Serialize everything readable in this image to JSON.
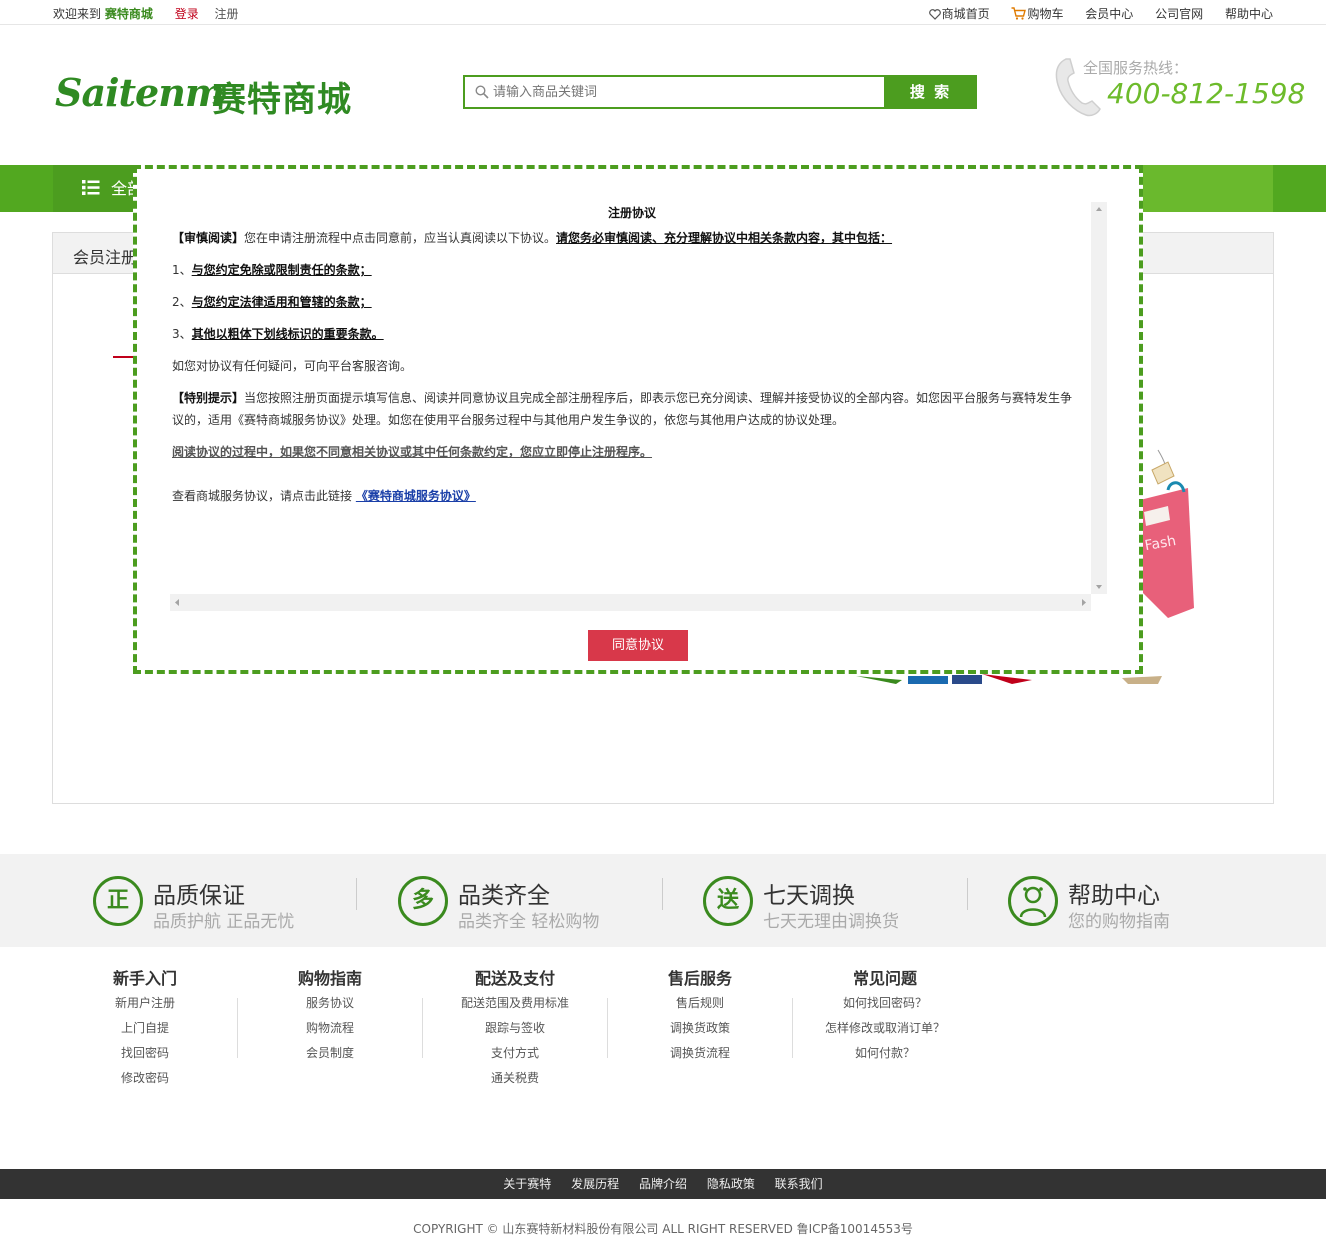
{
  "topbar": {
    "welcome": "欢迎来到",
    "brand": "赛特商城",
    "login": "登录",
    "register": "注册",
    "links": [
      "商城首页",
      "购物车",
      "会员中心",
      "公司官网",
      "帮助中心"
    ]
  },
  "header": {
    "logo_script": "Saitenm",
    "logo_cn": "赛特商城",
    "search_placeholder": "请输入商品关键词",
    "search_button": "搜 索",
    "hotline_label": "全国服务热线：",
    "hotline_number": "400-812-1598"
  },
  "nav": {
    "category_label": "全部"
  },
  "panel": {
    "title": "会员注册"
  },
  "modal": {
    "title": "注册协议",
    "p1_tag": "【审慎阅读】",
    "p1_text": "您在申请注册流程中点击同意前，应当认真阅读以下协议。",
    "p1_bold": "请您务必审慎阅读、充分理解协议中相关条款内容，其中包括：",
    "item1_num": "1、",
    "item1": "与您约定免除或限制责任的条款；",
    "item2_num": "2、",
    "item2": "与您约定法律适用和管辖的条款；",
    "item3_num": "3、",
    "item3": "其他以粗体下划线标识的重要条款。",
    "p2": "如您对协议有任何疑问，可向平台客服咨询。",
    "p3_tag": "【特别提示】",
    "p3_text": "当您按照注册页面提示填写信息、阅读并同意协议且完成全部注册程序后，即表示您已充分阅读、理解并接受协议的全部内容。如您因平台服务与赛特发生争议的，适用《赛特商城服务协议》处理。如您在使用平台服务过程中与其他用户发生争议的，依您与其他用户达成的协议处理。",
    "p4": "阅读协议的过程中，如果您不同意相关协议或其中任何条款约定，您应立即停止注册程序。",
    "p5_text": "查看商城服务协议，请点击此链接",
    "p5_link": "《赛特商城服务协议》",
    "agree_button": "同意协议"
  },
  "features": [
    {
      "icon": "正",
      "title": "品质保证",
      "sub": "品质护航 正品无忧"
    },
    {
      "icon": "多",
      "title": "品类齐全",
      "sub": "品类齐全 轻松购物"
    },
    {
      "icon": "送",
      "title": "七天调换",
      "sub": "七天无理由调换货"
    },
    {
      "icon": "",
      "title": "帮助中心",
      "sub": "您的购物指南"
    }
  ],
  "footer_columns": [
    {
      "heading": "新手入门",
      "items": [
        "新用户注册",
        "上门自提",
        "找回密码",
        "修改密码"
      ]
    },
    {
      "heading": "购物指南",
      "items": [
        "服务协议",
        "购物流程",
        "会员制度"
      ]
    },
    {
      "heading": "配送及支付",
      "items": [
        "配送范围及费用标准",
        "跟踪与签收",
        "支付方式",
        "通关税费"
      ]
    },
    {
      "heading": "售后服务",
      "items": [
        "售后规则",
        "调换货政策",
        "调换货流程"
      ]
    },
    {
      "heading": "常见问题",
      "items": [
        "如何找回密码？",
        "怎样修改或取消订单？",
        "如何付款？"
      ]
    }
  ],
  "bottom_links": [
    "关于赛特",
    "发展历程",
    "品牌介绍",
    "隐私政策",
    "联系我们"
  ],
  "copyright": "COPYRIGHT © 山东赛特新材料股份有限公司 ALL RIGHT RESERVED 鲁ICP备10014553号",
  "colors": {
    "brand_green": "#4c9d1f",
    "accent_red": "#d8384a",
    "hotline_green": "#6dbb2b"
  }
}
